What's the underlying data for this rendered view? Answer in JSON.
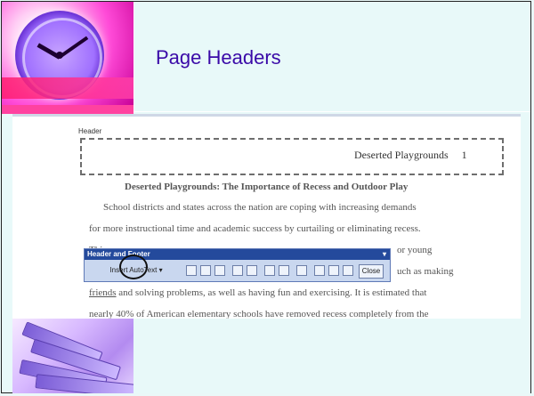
{
  "slide": {
    "title": "Page Headers"
  },
  "doc": {
    "header_tag": "Header",
    "header_text": "Deserted Playgrounds",
    "header_page": "1",
    "title": "Deserted Playgrounds: The Importance of Recess and Outdoor Play",
    "lines": {
      "l1": "School districts and states across the nation are coping with increasing demands",
      "l2": "for more instructional time and academic success by curtailing or eliminating recess.",
      "l3_left": "Thi",
      "l3_right": "or young",
      "l4_right": "uch as making",
      "l5_underlined": "friends",
      "l5_rest": " and solving problems, as well as having fun and exercising.  It is estimated that",
      "l6": "nearly 40% of American elementary schools have removed recess completely from the"
    }
  },
  "toolbar": {
    "title": "Header and Footer",
    "insert_autotext": "Insert AutoText ▾",
    "close": "Close"
  },
  "icons": {
    "clock": "clock-image",
    "books": "books-image",
    "circle_highlight": "annotation-circle"
  }
}
